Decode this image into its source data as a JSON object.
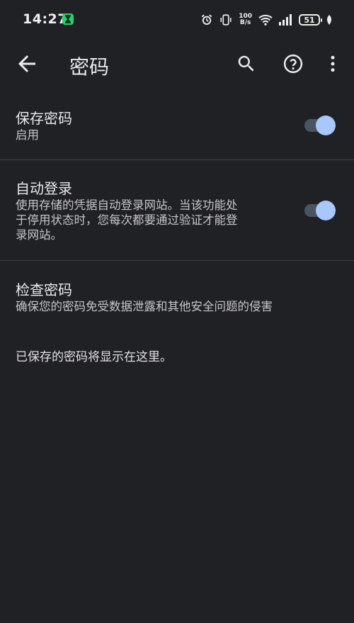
{
  "status_bar": {
    "time": "14:27",
    "net_speed_value": "100",
    "net_speed_unit": "B/s",
    "battery": "51",
    "accent_color": "#2ecc71"
  },
  "app_bar": {
    "title": "密码",
    "back_icon": "arrow-left-icon",
    "search_icon": "search-icon",
    "help_icon": "help-circle-icon",
    "more_icon": "more-vert-icon"
  },
  "settings": {
    "save_passwords": {
      "title": "保存密码",
      "subtitle": "启用",
      "enabled": true
    },
    "auto_signin": {
      "title": "自动登录",
      "subtitle_line1": "使用存储的凭据自动登录网站。当该功能处",
      "subtitle_line2": "于停用状态时，您每次都要通过验证才能登",
      "subtitle_line3": "录网站。",
      "enabled": true
    },
    "check_passwords": {
      "title": "检查密码",
      "subtitle": "确保您的密码免受数据泄露和其他安全问题的侵害"
    }
  },
  "empty_message": "已保存的密码将显示在这里。",
  "colors": {
    "background": "#202124",
    "toggle_thumb": "#a8c7fa",
    "toggle_track": "#4a5563"
  }
}
